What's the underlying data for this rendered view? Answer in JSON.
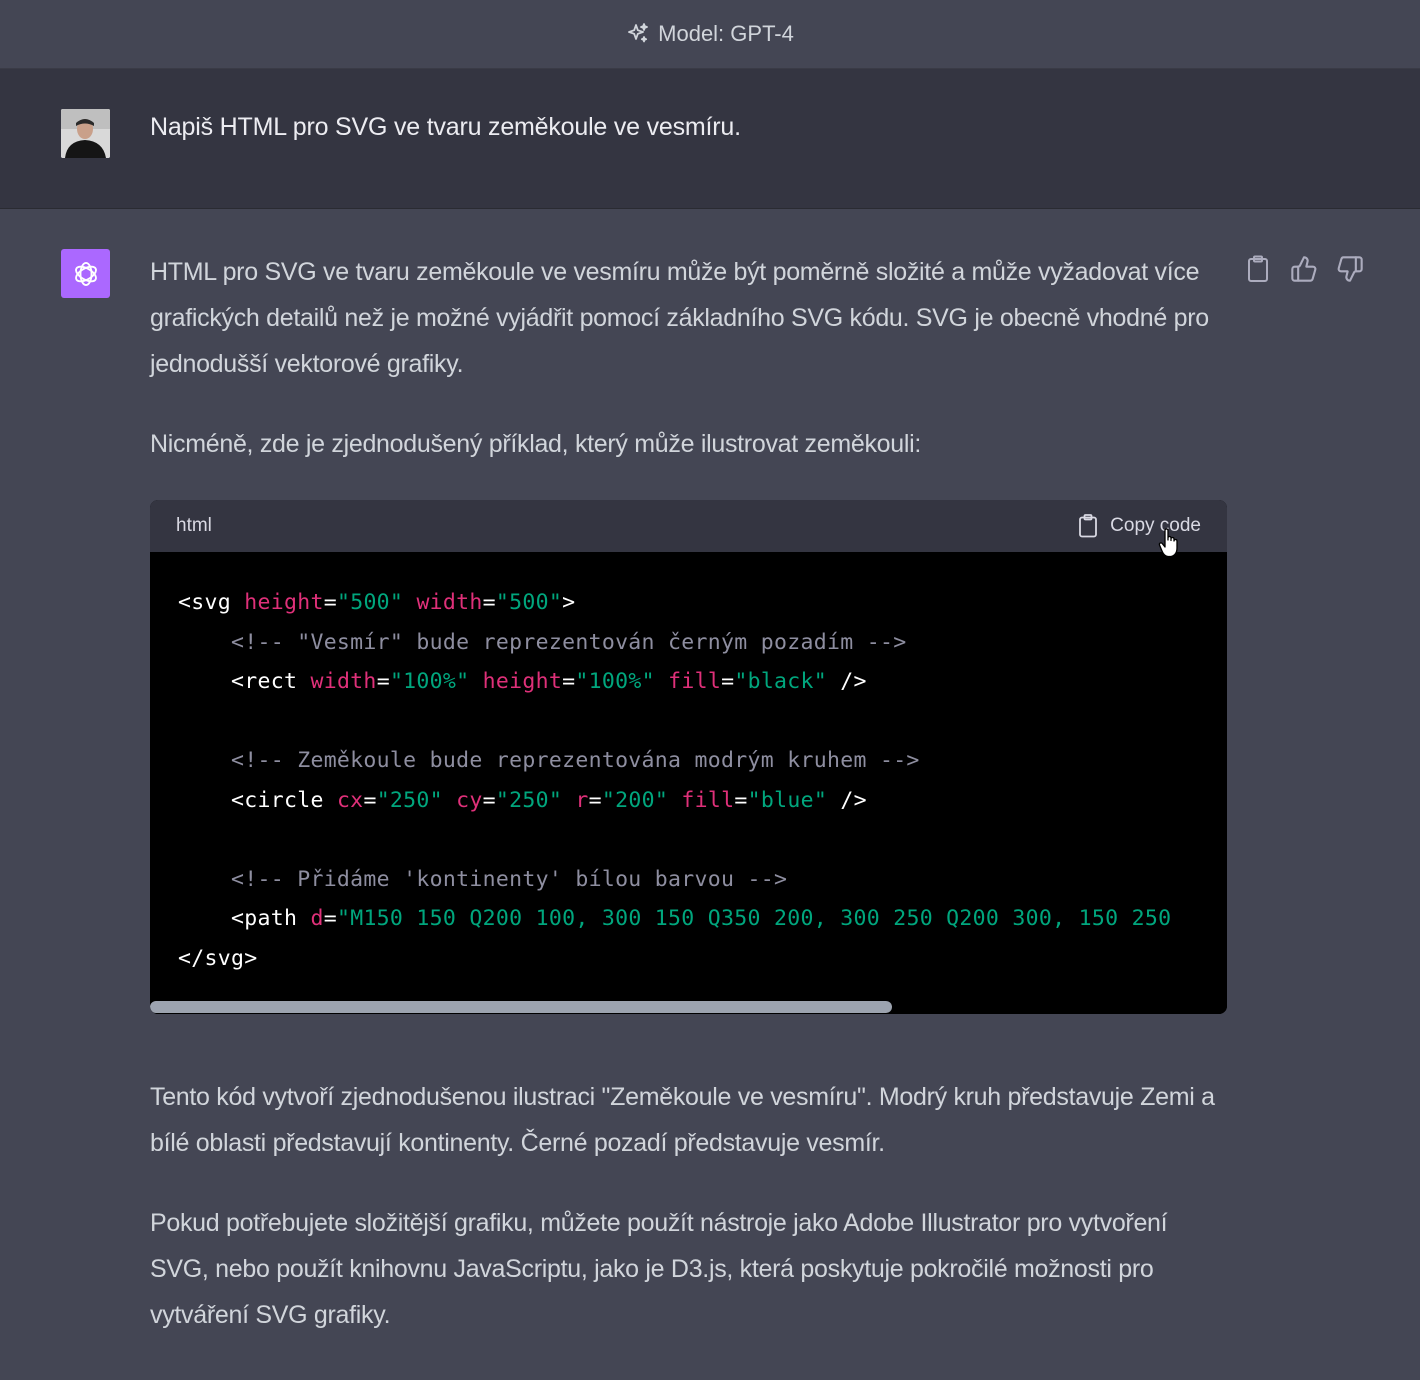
{
  "header": {
    "model_label": "Model: GPT-4",
    "icon": "sparkle-icon"
  },
  "user_message": {
    "text": "Napiš HTML pro SVG ve tvaru zeměkoule ve vesmíru."
  },
  "assistant": {
    "paragraphs": [
      "HTML pro SVG ve tvaru zeměkoule ve vesmíru může být poměrně složité a může vyžadovat více grafických detailů než je možné vyjádřit pomocí základního SVG kódu. SVG je obecně vhodné pro jednodušší vektorové grafiky.",
      "Nicméně, zde je zjednodušený příklad, který může ilustrovat zeměkouli:",
      "Tento kód vytvoří zjednodušenou ilustraci \"Zeměkoule ve vesmíru\". Modrý kruh představuje Zemi a bílé oblasti představují kontinenty. Černé pozadí představuje vesmír.",
      "Pokud potřebujete složitější grafiku, můžete použít nástroje jako Adobe Illustrator pro vytvoření SVG, nebo použít knihovnu JavaScriptu, jako je D3.js, která poskytuje pokročilé možnosti pro vytváření SVG grafiky."
    ],
    "actions": [
      "clipboard-icon",
      "thumbs-up-icon",
      "thumbs-down-icon"
    ]
  },
  "code": {
    "language": "html",
    "copy_label": "Copy code",
    "lines": {
      "l1": {
        "t1": "<svg ",
        "a1": "height",
        "e1": "=",
        "s1": "\"500\"",
        "sp1": " ",
        "a2": "width",
        "e2": "=",
        "s2": "\"500\"",
        "t2": ">"
      },
      "l2": {
        "c": "<!-- \"Vesmír\" bude reprezentován černým pozadím -->"
      },
      "l3": {
        "t1": "<rect ",
        "a1": "width",
        "e1": "=",
        "s1": "\"100%\"",
        "a2": "height",
        "e2": "=",
        "s2": "\"100%\"",
        "a3": "fill",
        "e3": "=",
        "s3": "\"black\"",
        "t2": " />"
      },
      "l5": {
        "c": "<!-- Zeměkoule bude reprezentována modrým kruhem -->"
      },
      "l6": {
        "t1": "<circle ",
        "a1": "cx",
        "e1": "=",
        "s1": "\"250\"",
        "a2": "cy",
        "e2": "=",
        "s2": "\"250\"",
        "a3": "r",
        "e3": "=",
        "s3": "\"200\"",
        "a4": "fill",
        "e4": "=",
        "s4": "\"blue\"",
        "t2": " />"
      },
      "l8": {
        "c": "<!-- Přidáme 'kontinenty' bílou barvou -->"
      },
      "l9": {
        "t1": "<path ",
        "a1": "d",
        "e1": "=",
        "s1": "\"M150 150 Q200 100, 300 150 Q350 200, 300 250 Q200 300, 150 250"
      },
      "l10": {
        "t1": "</svg>"
      }
    }
  },
  "colors": {
    "background": "#444654",
    "user_row": "#343541",
    "code_bg": "#000000",
    "code_header": "#343541",
    "attr": "#df3079",
    "string": "#00a67d",
    "comment": "#8e8ea0",
    "ai_avatar": "#ab68ff"
  }
}
